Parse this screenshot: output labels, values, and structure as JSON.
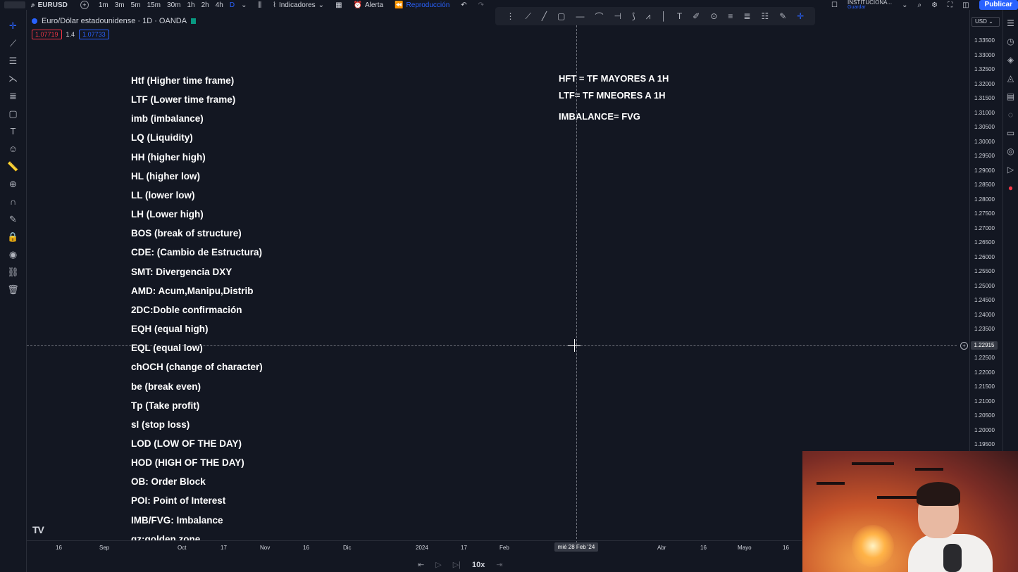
{
  "topbar": {
    "symbol": "EURUSD",
    "intervals": [
      "1m",
      "3m",
      "5m",
      "15m",
      "30m",
      "1h",
      "2h",
      "4h",
      "D"
    ],
    "active_interval": "D",
    "indicators_label": "Indicadores",
    "alert_label": "Alerta",
    "replay_label": "Reproducción",
    "institutional_label": "INSTITUCIONA...",
    "save_label": "Guardar",
    "publish_label": "Publicar"
  },
  "chart": {
    "title": "Euro/Dólar estadounidense · 1D · OANDA",
    "bid": "1.07719",
    "spread": "1.4",
    "ask": "1.07733",
    "currency": "USD"
  },
  "glossary": [
    "Htf (Higher time frame)",
    "LTF (Lower time frame)",
    "imb (imbalance)",
    "LQ (Liquidity)",
    "HH (higher high)",
    "HL (higher low)",
    "LL (lower low)",
    "LH (Lower high)",
    "BOS (break of structure)",
    "CDE: (Cambio de Estructura)",
    "SMT: Divergencia DXY",
    "AMD: Acum,Manipu,Distrib",
    "2DC:Doble confirmación",
    "EQH (equal high)",
    "EQL (equal low)",
    "chOCH (change of character)",
    "be (break even)",
    "Tp (Take profit)",
    "sl (stop loss)",
    "LOD (LOW OF THE DAY)",
    "HOD (HIGH OF THE DAY)",
    "OB: Order Block",
    "POI: Point of Interest",
    "IMB/FVG: Imbalance",
    "gz:golden zone"
  ],
  "notes": [
    "HFT = TF MAYORES A 1H",
    "LTF= TF MNEORES A 1H",
    "IMBALANCE= FVG"
  ],
  "price_ticks": [
    "1.33500",
    "1.33000",
    "1.32500",
    "1.32000",
    "1.31500",
    "1.31000",
    "1.30500",
    "1.30000",
    "1.29500",
    "1.29000",
    "1.28500",
    "1.28000",
    "1.27500",
    "1.27000",
    "1.26500",
    "1.26000",
    "1.25500",
    "1.25000",
    "1.24500",
    "1.24000",
    "1.23500",
    "1.22500",
    "1.22000",
    "1.21500",
    "1.21000",
    "1.20500",
    "1.20000",
    "1.19500"
  ],
  "crosshair_price": "1.22915",
  "crosshair_date": "mié 28 Feb '24",
  "time_ticks": [
    "16",
    "Sep",
    "Oct",
    "17",
    "Nov",
    "16",
    "Dic",
    "2024",
    "17",
    "Feb",
    "Abr",
    "16",
    "Mayo",
    "16"
  ],
  "replay": {
    "speed": "10x"
  },
  "colors": {
    "background": "#131722",
    "accent": "#2962ff",
    "text": "#ffffff"
  }
}
